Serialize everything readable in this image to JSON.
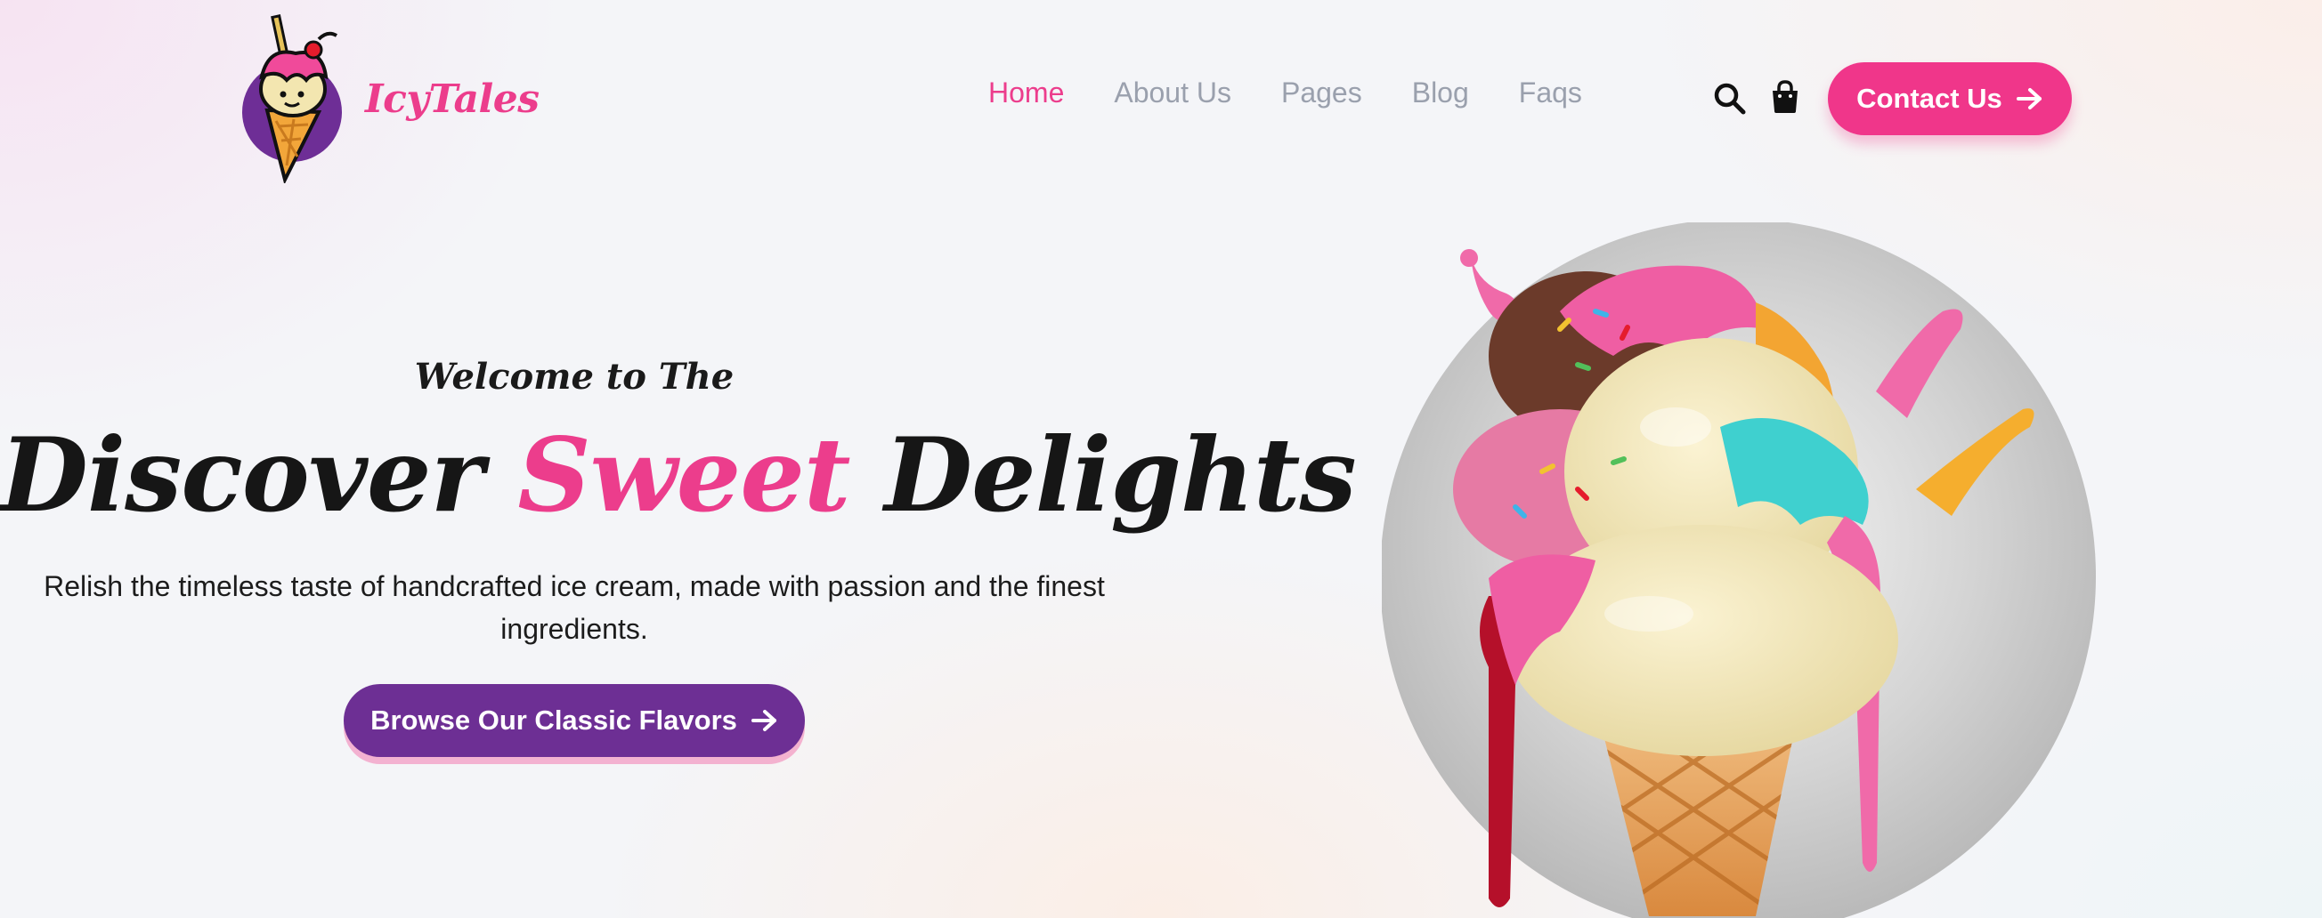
{
  "brand": {
    "name": "IcyTales"
  },
  "nav": {
    "items": [
      {
        "label": "Home",
        "active": true
      },
      {
        "label": "About Us",
        "active": false
      },
      {
        "label": "Pages",
        "active": false
      },
      {
        "label": "Blog",
        "active": false
      },
      {
        "label": "Faqs",
        "active": false
      }
    ]
  },
  "header_actions": {
    "search_icon": "search-icon",
    "cart_icon": "shopping-bag-icon",
    "contact_label": "Contact Us"
  },
  "hero": {
    "welcome": "Welcome to The",
    "headline_part1": "Discover",
    "headline_accent": "Sweet",
    "headline_part2": "Delights",
    "subtitle": "Relish the timeless taste of handcrafted ice cream, made with passion and the finest ingredients.",
    "cta_label": "Browse Our Classic Flavors",
    "image": "ice-cream-cone-illustration"
  },
  "colors": {
    "accent_pink": "#ec3d8c",
    "cta_purple": "#6d2f94",
    "nav_inactive": "#9aa0ad",
    "text_dark": "#161616"
  }
}
